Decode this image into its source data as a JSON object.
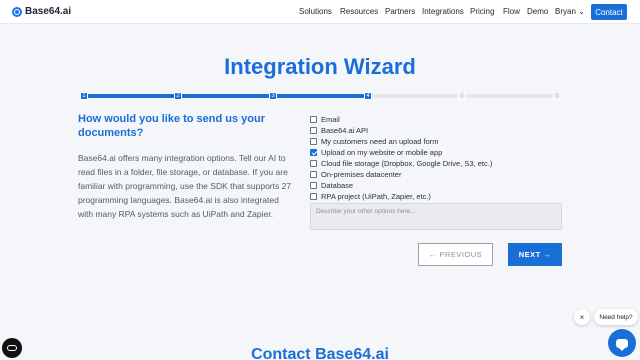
{
  "nav": {
    "logo": "Base64.ai",
    "links": [
      "Solutions",
      "Resources",
      "Partners",
      "Integrations",
      "Pricing",
      "Flow",
      "Demo",
      "Bryan ⌄"
    ],
    "contact": "Contact"
  },
  "wizard": {
    "title": "Integration Wizard",
    "steps": [
      "1",
      "2",
      "3",
      "4",
      "5",
      "6"
    ],
    "current_step": 4,
    "question": "How would you like to send us your documents?",
    "description": "Base64.ai offers many integration options. Tell our AI to read files in a folder, file storage, or database. If you are familiar with programming, use the SDK that supports 27 programming languages. Base64.ai is also integrated with many RPA systems such as UiPath and Zapier.",
    "options": [
      {
        "label": "Email",
        "checked": false
      },
      {
        "label": "Base64.ai API",
        "checked": false
      },
      {
        "label": "My customers need an upload form",
        "checked": false
      },
      {
        "label": "Upload on my website or mobile app",
        "checked": true
      },
      {
        "label": "Cloud file storage (Dropbox, Google Drive, S3, etc.)",
        "checked": false
      },
      {
        "label": "On-premises datacenter",
        "checked": false
      },
      {
        "label": "Database",
        "checked": false
      },
      {
        "label": "RPA project (UiPath, Zapier, etc.)",
        "checked": false
      }
    ],
    "other_placeholder": "Describe your other options here...",
    "prev_label": "← PREVIOUS",
    "next_label": "NEXT →"
  },
  "help": {
    "close": "×",
    "bubble": "Need help?"
  },
  "footer": {
    "contact_heading": "Contact Base64.ai"
  }
}
